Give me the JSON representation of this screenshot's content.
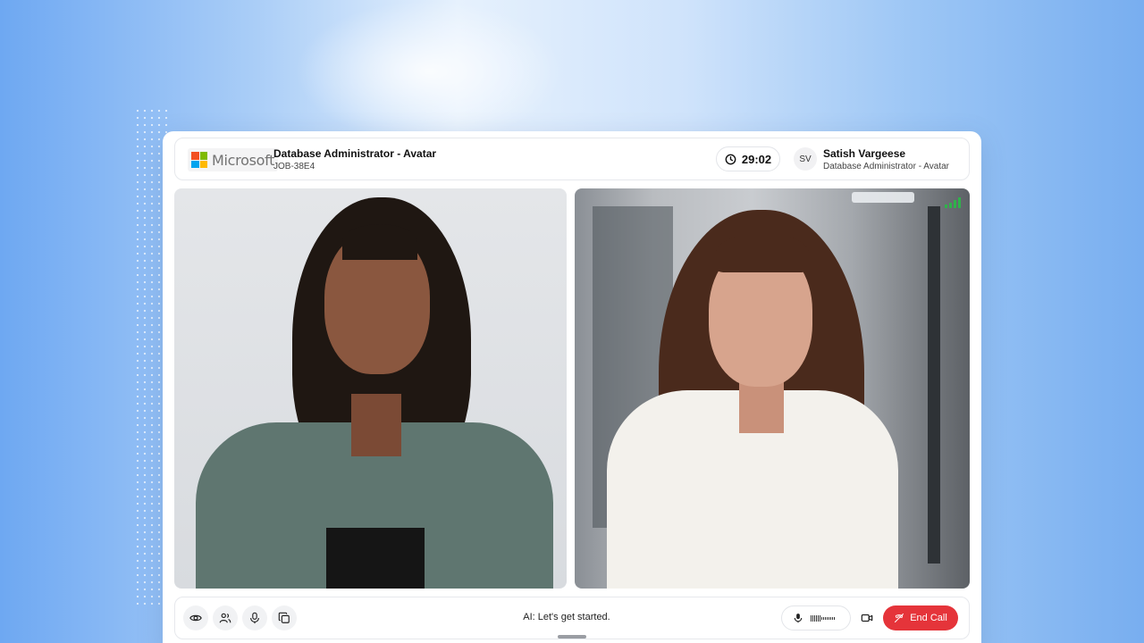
{
  "header": {
    "company": "Microsoft",
    "job_title": "Database Administrator - Avatar",
    "job_code": "JOB-38E4",
    "timer": "29:02",
    "user_initials": "SV",
    "user_name": "Satish Vargeese",
    "user_role": "Database Administrator - Avatar"
  },
  "controls": {
    "left_icons": [
      "eye-icon",
      "people-icon",
      "mic-icon",
      "copy-icon"
    ],
    "caption": "AI: Let's get started.",
    "mic_level": 0.4,
    "end_call_label": "End Call"
  },
  "colors": {
    "end_call": "#e5343a",
    "signal": "#2fb24a",
    "ms_red": "#f25022",
    "ms_green": "#7fba00",
    "ms_blue": "#00a4ef",
    "ms_yellow": "#ffb900"
  }
}
